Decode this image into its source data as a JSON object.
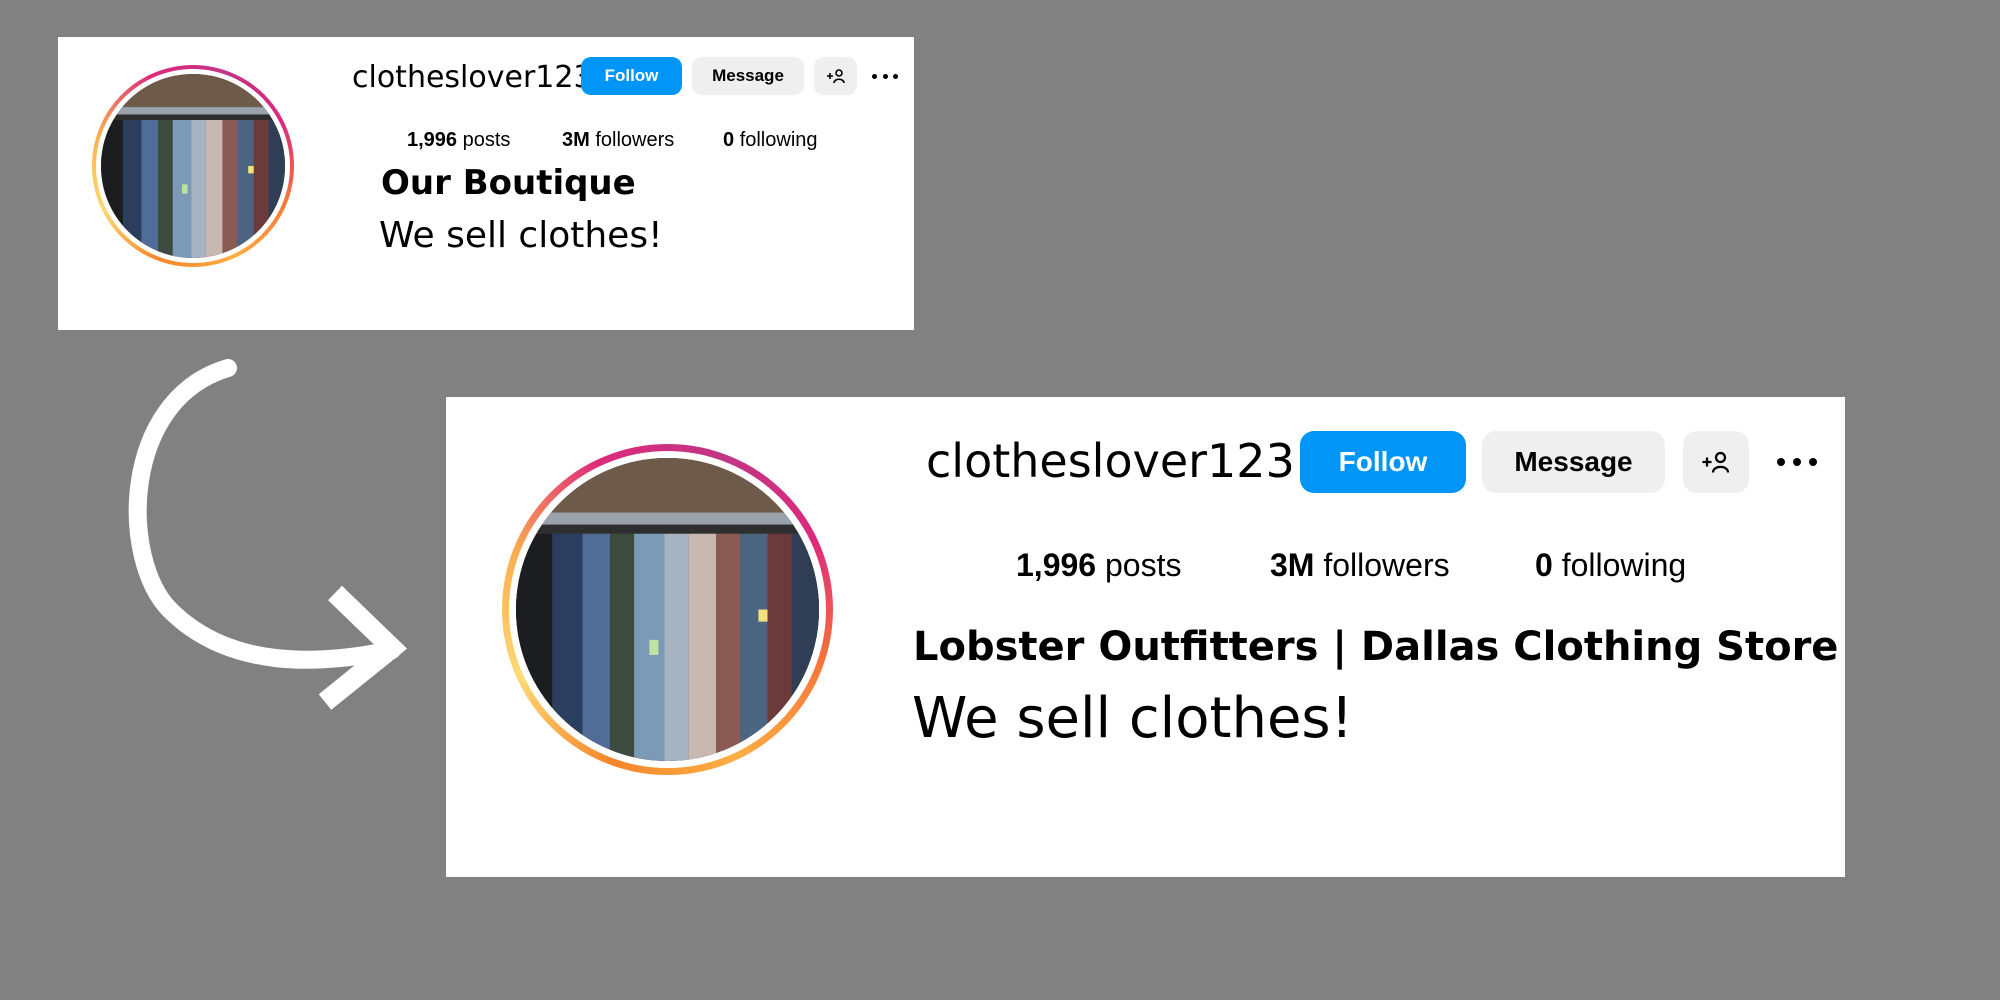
{
  "before": {
    "username": "clotheslover123",
    "follow_label": "Follow",
    "message_label": "Message",
    "add_person_icon": "add-person-icon",
    "more_icon": "more-options-icon",
    "stats": {
      "posts_count": "1,996",
      "posts_label": "posts",
      "followers_count": "3M",
      "followers_label": "followers",
      "following_count": "0",
      "following_label": "following"
    },
    "bio_name": "Our Boutique",
    "bio_text": "We sell clothes!"
  },
  "after": {
    "username": "clotheslover123",
    "follow_label": "Follow",
    "message_label": "Message",
    "add_person_icon": "add-person-icon",
    "more_icon": "more-options-icon",
    "stats": {
      "posts_count": "1,996",
      "posts_label": "posts",
      "followers_count": "3M",
      "followers_label": "followers",
      "following_count": "0",
      "following_label": "following"
    },
    "bio_name": "Lobster Outfitters | Dallas Clothing Store",
    "bio_text": "We sell clothes!"
  },
  "colors": {
    "background": "#818181",
    "follow_button": "#0095f6",
    "secondary_button": "#efefef",
    "arrow": "#ffffff"
  }
}
